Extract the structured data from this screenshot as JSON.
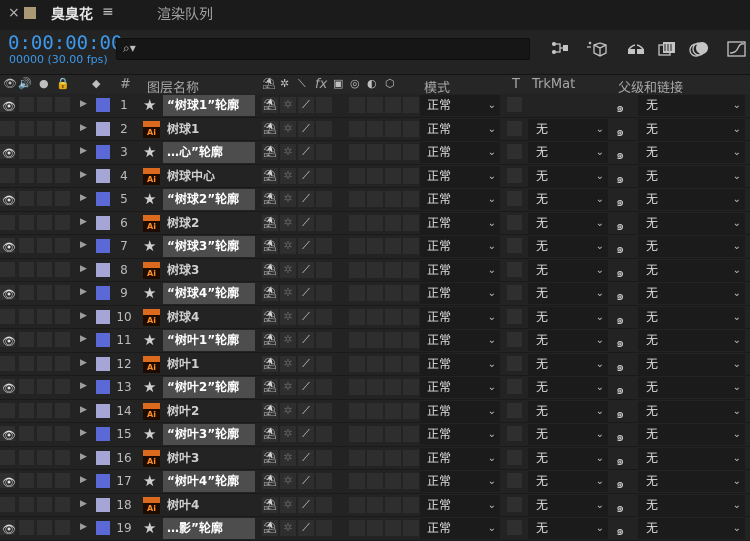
{
  "app": {
    "tab_close": "×",
    "comp_tab_title": "臭臭花",
    "tab_menu": "≡",
    "render_queue_tab": "渲染队列",
    "comp_swatch_color": "#ab9875"
  },
  "time": {
    "timecode": "0:00:00:00",
    "frames_fps": "00000 (30.00 fps)"
  },
  "search": {
    "icon": "⌕▾",
    "placeholder": ""
  },
  "toolbar": {
    "icons": [
      "compositing-flowchart-icon",
      "draft-3d-icon",
      "shy-layers-icon",
      "frame-blending-icon",
      "motion-blur-icon",
      "graph-editor-icon"
    ]
  },
  "header": {
    "label_col": "图层名称",
    "hash": "#",
    "mode": "模式",
    "t": "T",
    "trkmat": "TrkMat",
    "parent": "父级和链接",
    "switch_fx": "fx"
  },
  "colors": {
    "shape_label": "#5b69d6",
    "ai_label": "#a5a6d6",
    "accent_blue": "#3c98ea"
  },
  "layers": [
    {
      "num": "1",
      "type": "shape",
      "name": "“树球1”轮廓",
      "mode": "正常",
      "trkmat": "",
      "parent": "无",
      "visible": true
    },
    {
      "num": "2",
      "type": "ai",
      "name": "树球1",
      "mode": "正常",
      "trkmat": "无",
      "parent": "无",
      "visible": false
    },
    {
      "num": "3",
      "type": "shape",
      "name": "…心”轮廓",
      "mode": "正常",
      "trkmat": "无",
      "parent": "无",
      "visible": true
    },
    {
      "num": "4",
      "type": "ai",
      "name": "树球中心",
      "mode": "正常",
      "trkmat": "无",
      "parent": "无",
      "visible": false
    },
    {
      "num": "5",
      "type": "shape",
      "name": "“树球2”轮廓",
      "mode": "正常",
      "trkmat": "无",
      "parent": "无",
      "visible": true
    },
    {
      "num": "6",
      "type": "ai",
      "name": "树球2",
      "mode": "正常",
      "trkmat": "无",
      "parent": "无",
      "visible": false
    },
    {
      "num": "7",
      "type": "shape",
      "name": "“树球3”轮廓",
      "mode": "正常",
      "trkmat": "无",
      "parent": "无",
      "visible": true
    },
    {
      "num": "8",
      "type": "ai",
      "name": "树球3",
      "mode": "正常",
      "trkmat": "无",
      "parent": "无",
      "visible": false
    },
    {
      "num": "9",
      "type": "shape",
      "name": "“树球4”轮廓",
      "mode": "正常",
      "trkmat": "无",
      "parent": "无",
      "visible": true
    },
    {
      "num": "10",
      "type": "ai",
      "name": "树球4",
      "mode": "正常",
      "trkmat": "无",
      "parent": "无",
      "visible": false
    },
    {
      "num": "11",
      "type": "shape",
      "name": "“树叶1”轮廓",
      "mode": "正常",
      "trkmat": "无",
      "parent": "无",
      "visible": true
    },
    {
      "num": "12",
      "type": "ai",
      "name": "树叶1",
      "mode": "正常",
      "trkmat": "无",
      "parent": "无",
      "visible": false
    },
    {
      "num": "13",
      "type": "shape",
      "name": "“树叶2”轮廓",
      "mode": "正常",
      "trkmat": "无",
      "parent": "无",
      "visible": true
    },
    {
      "num": "14",
      "type": "ai",
      "name": "树叶2",
      "mode": "正常",
      "trkmat": "无",
      "parent": "无",
      "visible": false
    },
    {
      "num": "15",
      "type": "shape",
      "name": "“树叶3”轮廓",
      "mode": "正常",
      "trkmat": "无",
      "parent": "无",
      "visible": true
    },
    {
      "num": "16",
      "type": "ai",
      "name": "树叶3",
      "mode": "正常",
      "trkmat": "无",
      "parent": "无",
      "visible": false
    },
    {
      "num": "17",
      "type": "shape",
      "name": "“树叶4”轮廓",
      "mode": "正常",
      "trkmat": "无",
      "parent": "无",
      "visible": true
    },
    {
      "num": "18",
      "type": "ai",
      "name": "树叶4",
      "mode": "正常",
      "trkmat": "无",
      "parent": "无",
      "visible": false
    },
    {
      "num": "19",
      "type": "shape",
      "name": "…影”轮廓",
      "mode": "正常",
      "trkmat": "无",
      "parent": "无",
      "visible": true
    }
  ]
}
